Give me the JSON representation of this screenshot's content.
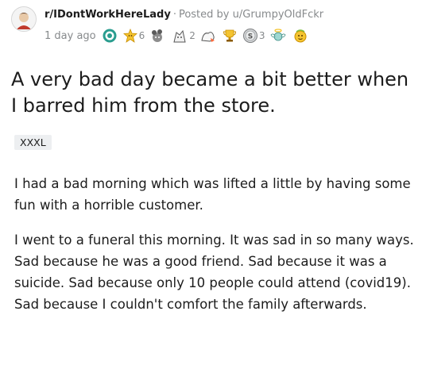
{
  "post": {
    "subreddit": "r/IDontWorkHereLady",
    "separator": "·",
    "posted_by_prefix": "Posted by",
    "author": "u/GrumpyOldFckr",
    "time": "1 day ago",
    "awards": [
      {
        "icon": "helpful-award-icon",
        "count": ""
      },
      {
        "icon": "wholesome-award-icon",
        "count": "6"
      },
      {
        "icon": "mind-blown-award-icon",
        "count": ""
      },
      {
        "icon": "bravo-award-icon",
        "count": "2"
      },
      {
        "icon": "hugz-award-icon",
        "count": ""
      },
      {
        "icon": "trophy-award-icon",
        "count": ""
      },
      {
        "icon": "silver-award-icon",
        "count": "3"
      },
      {
        "icon": "angel-award-icon",
        "count": ""
      },
      {
        "icon": "gold-award-icon",
        "count": ""
      }
    ],
    "title": "A very bad day became a bit better when I barred him from the store.",
    "flair": "XXXL",
    "body": [
      "I had a bad morning which was lifted a little by having some fun with a horrible customer.",
      "I went to a funeral this morning. It was sad in so many ways. Sad because he was a good friend. Sad because it was a suicide. Sad because only 10 people could attend (covid19). Sad because I couldn't comfort the family afterwards."
    ]
  },
  "colors": {
    "text": "#1c1c1c",
    "meta": "#878a8c",
    "flair_bg": "#edeff1"
  }
}
